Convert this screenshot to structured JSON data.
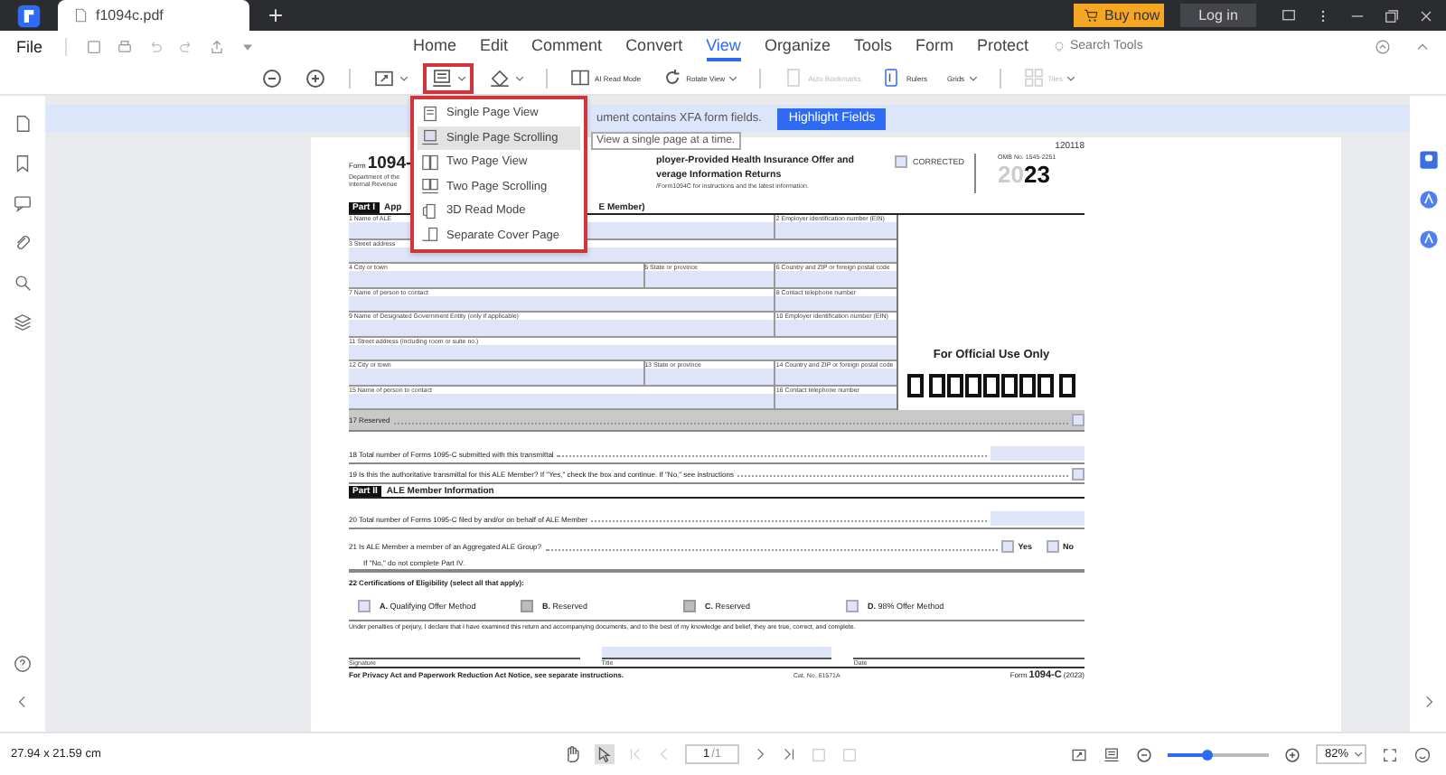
{
  "window": {
    "tab_title": "f1094c.pdf",
    "buy_button": "Buy now",
    "login_button": "Log in"
  },
  "menu": {
    "file": "File",
    "tabs": [
      {
        "label": "Home",
        "selected": false
      },
      {
        "label": "Edit",
        "selected": false
      },
      {
        "label": "Comment",
        "selected": false
      },
      {
        "label": "Convert",
        "selected": false
      },
      {
        "label": "View",
        "selected": true
      },
      {
        "label": "Organize",
        "selected": false
      },
      {
        "label": "Tools",
        "selected": false
      },
      {
        "label": "Form",
        "selected": false
      },
      {
        "label": "Protect",
        "selected": false
      }
    ],
    "search_placeholder": "Search Tools"
  },
  "toolbar": {
    "layout_menu_open": true,
    "buttons": [
      {
        "label": "AI Read Mode",
        "disabled": false,
        "caret": false
      },
      {
        "label": "Rotate View",
        "disabled": false,
        "caret": true
      },
      {
        "label": "Auto Bookmarks",
        "disabled": true,
        "caret": false
      },
      {
        "label": "Rulers",
        "disabled": false,
        "caret": false
      },
      {
        "label": "Grids",
        "disabled": false,
        "caret": true
      },
      {
        "label": "Tiles",
        "disabled": true,
        "caret": true
      }
    ]
  },
  "notice": {
    "text": "ument contains XFA form fields.",
    "button": "Highlight Fields"
  },
  "layout_menu": {
    "items": [
      {
        "label": "Single Page View",
        "selected": false
      },
      {
        "label": "Single Page Scrolling",
        "selected": true
      },
      {
        "label": "Two Page View",
        "selected": false
      },
      {
        "label": "Two Page Scrolling",
        "selected": false
      },
      {
        "label": "3D Read Mode",
        "selected": false
      },
      {
        "label": "Separate Cover Page",
        "selected": false
      }
    ]
  },
  "tooltip": "View a single page at a time.",
  "form": {
    "code": "120118",
    "form_word": "Form",
    "number": "1094-",
    "dept": [
      "Department of the",
      "Internal Revenue"
    ],
    "title": [
      "ployer-Provided Health Insurance Offer and",
      "verage Information Returns"
    ],
    "instructions": "/Form1094C for instructions and the latest information.",
    "corrected": {
      "label": "CORRECTED",
      "checked": false
    },
    "omb": "OMB No. 1545-2251",
    "year": "20**23**",
    "part1": {
      "badge": "Part I",
      "title_left": "App",
      "title_right": "E Member)"
    },
    "field_rows": [
      [
        "1 Name of ALE",
        "2 Employer identification number (EIN)"
      ],
      [
        "3 Street address"
      ],
      [
        "4 City or town",
        "5 State or province",
        "6 Country and ZIP or foreign postal code"
      ],
      [
        "7 Name of person to contact",
        "8 Contact telephone number"
      ],
      [
        "9 Name of Designated Government Entity (only if applicable)",
        "10 Employer identification number (EIN)"
      ],
      [
        "11 Street address (including room or suite no.)"
      ],
      [
        "12 City or town",
        "13 State or province",
        "14 Country and ZIP or foreign postal code"
      ],
      [
        "15 Name of person to contact",
        "16 Contact telephone number"
      ]
    ],
    "official_use": "For Official Use Only",
    "lines": [
      {
        "kind": "reserved",
        "label": "17 Reserved",
        "checked": false
      },
      {
        "kind": "field",
        "label": "18 Total number of Forms 1095-C submitted with this transmittal"
      },
      {
        "kind": "checkbox",
        "label": "19 Is this the authoritative transmittal for this ALE Member? If \"Yes,\" check the box and continue. If \"No,\" see instructions",
        "checked": false
      },
      {
        "kind": "part",
        "badge": "Part II",
        "title": "ALE Member Information"
      },
      {
        "kind": "field",
        "label": "20 Total number of Forms 1095-C filed by and/or on behalf of ALE Member"
      },
      {
        "kind": "yesno",
        "label": "21 Is ALE Member a member of an Aggregated ALE Group?",
        "note": "If \"No,\" do not complete Part IV.",
        "options": [
          {
            "label": "Yes",
            "checked": false
          },
          {
            "label": "No",
            "checked": false
          }
        ]
      },
      {
        "kind": "certs",
        "label": "22 Certifications of Eligibility (select all that apply):",
        "options": [
          {
            "label": "**A.** Qualifying Offer Method",
            "checked": false,
            "disabled": false
          },
          {
            "label": "**B.** Reserved",
            "checked": false,
            "disabled": true
          },
          {
            "label": "**C.** Reserved",
            "checked": false,
            "disabled": true
          },
          {
            "label": "**D.** 98% Offer Method",
            "checked": false,
            "disabled": false
          }
        ]
      }
    ],
    "declaration": "Under penalties of perjury, I declare that I have examined this return and accompanying documents, and to the best of my knowledge and belief, they are true, correct, and complete.",
    "signature": [
      "Signature",
      "Title",
      "Date"
    ],
    "footer": {
      "left": "For Privacy Act and Paperwork Reduction Act Notice, see separate instructions.",
      "center": "Cat. No. 61571A",
      "right": "Form **1094-C** (2023)"
    }
  },
  "status_bar": {
    "page_size": "27.94 x 21.59 cm",
    "page": "1",
    "page_count": "/1",
    "zoom_slider": {
      "level": 0.4
    },
    "zoom": "82%"
  }
}
